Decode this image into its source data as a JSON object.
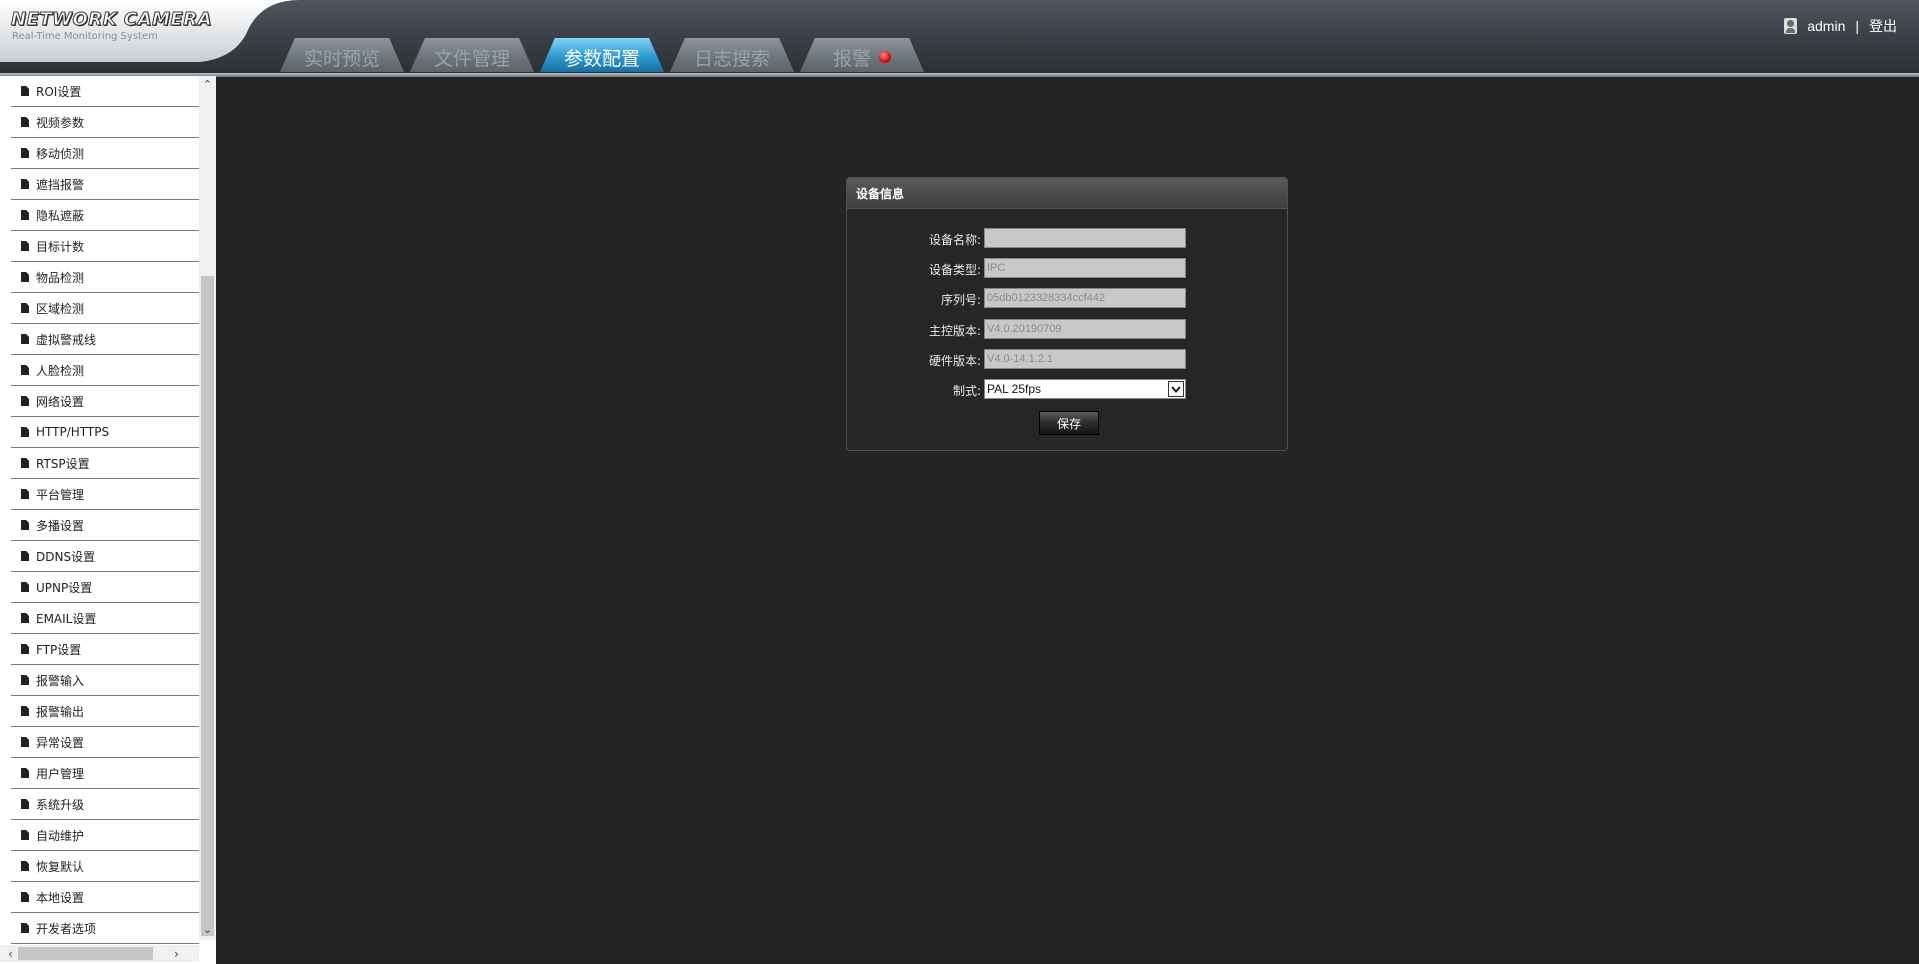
{
  "header": {
    "logo_title": "NETWORK CAMERA",
    "logo_subtitle": "Real-Time Monitoring System",
    "tabs": [
      {
        "label": "实时预览"
      },
      {
        "label": "文件管理"
      },
      {
        "label": "参数配置"
      },
      {
        "label": "日志搜索"
      },
      {
        "label": "报警"
      }
    ],
    "active_tab": "参数配置",
    "user": "admin",
    "separator": "|",
    "logout": "登出",
    "accent_color": "#2e9bd0",
    "alarm_color": "#e01010"
  },
  "sidebar": {
    "items": [
      {
        "label": "ROI设置"
      },
      {
        "label": "视频参数"
      },
      {
        "label": "移动侦测"
      },
      {
        "label": "遮挡报警"
      },
      {
        "label": "隐私遮蔽"
      },
      {
        "label": "目标计数"
      },
      {
        "label": "物品检测"
      },
      {
        "label": "区域检测"
      },
      {
        "label": "虚拟警戒线"
      },
      {
        "label": "人脸检测"
      },
      {
        "label": "网络设置"
      },
      {
        "label": "HTTP/HTTPS"
      },
      {
        "label": "RTSP设置"
      },
      {
        "label": "平台管理"
      },
      {
        "label": "多播设置"
      },
      {
        "label": "DDNS设置"
      },
      {
        "label": "UPNP设置"
      },
      {
        "label": "EMAIL设置"
      },
      {
        "label": "FTP设置"
      },
      {
        "label": "报警输入"
      },
      {
        "label": "报警输出"
      },
      {
        "label": "异常设置"
      },
      {
        "label": "用户管理"
      },
      {
        "label": "系统升级"
      },
      {
        "label": "自动维护"
      },
      {
        "label": "恢复默认"
      },
      {
        "label": "本地设置"
      },
      {
        "label": "开发者选项"
      }
    ]
  },
  "device_info": {
    "title": "设备信息",
    "fields": [
      {
        "label": "设备名称:",
        "value": ""
      },
      {
        "label": "设备类型:",
        "value": "IPC"
      },
      {
        "label": "序列号:",
        "value": "05db0123328334ccf442"
      },
      {
        "label": "主控版本:",
        "value": "V4.0.20190709"
      },
      {
        "label": "硬件版本:",
        "value": "V4.0-14.1.2.1"
      }
    ],
    "standard_label": "制式:",
    "standard_value": "PAL 25fps",
    "save_label": "保存"
  }
}
